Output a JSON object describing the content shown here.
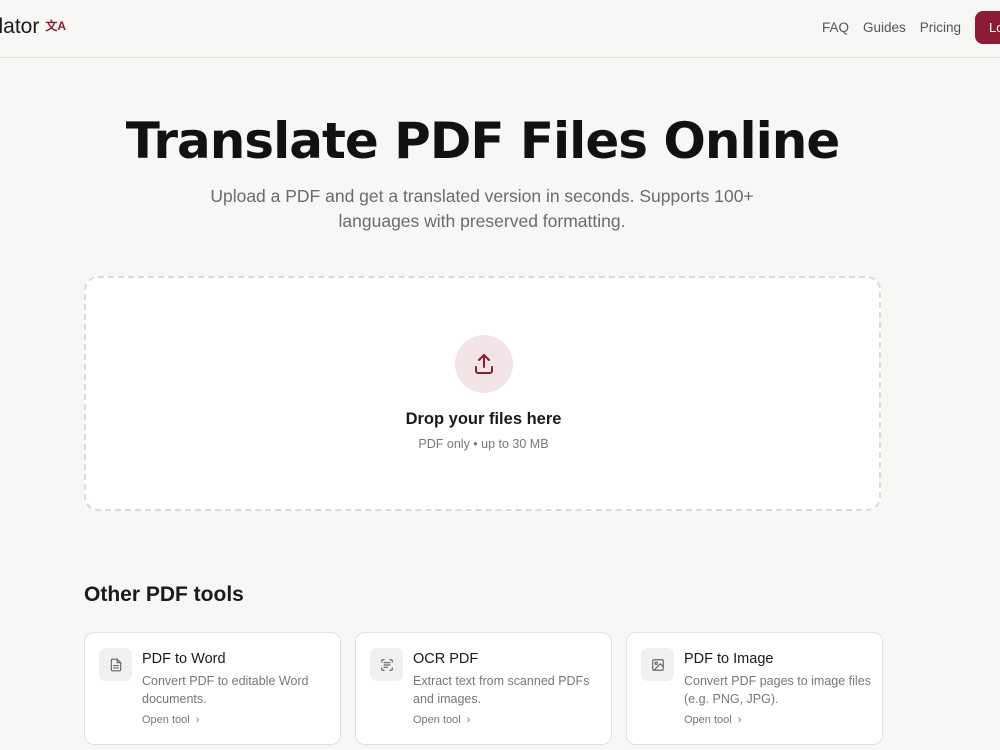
{
  "header": {
    "brand": "slator",
    "nav": [
      "FAQ",
      "Guides",
      "Pricing"
    ],
    "login_label": "Lo",
    "accent_color": "#8b1c33"
  },
  "hero": {
    "title": "Translate PDF Files Online",
    "subtitle": "Upload a PDF and get a translated version in seconds. Supports 100+ languages with preserved formatting."
  },
  "dropzone": {
    "icon": "upload-icon",
    "title": "Drop your files here",
    "hint": "PDF only • up to 30 MB"
  },
  "tools": {
    "heading": "Other PDF tools",
    "items": [
      {
        "icon": "document-icon",
        "title": "PDF to Word",
        "desc": "Convert PDF to editable Word documents.",
        "link": "Open tool"
      },
      {
        "icon": "scan-text-icon",
        "title": "OCR PDF",
        "desc": "Extract text from scanned PDFs and images.",
        "link": "Open tool"
      },
      {
        "icon": "image-icon",
        "title": "PDF to Image",
        "desc": "Convert PDF pages to image files (e.g. PNG, JPG).",
        "link": "Open tool"
      }
    ]
  }
}
